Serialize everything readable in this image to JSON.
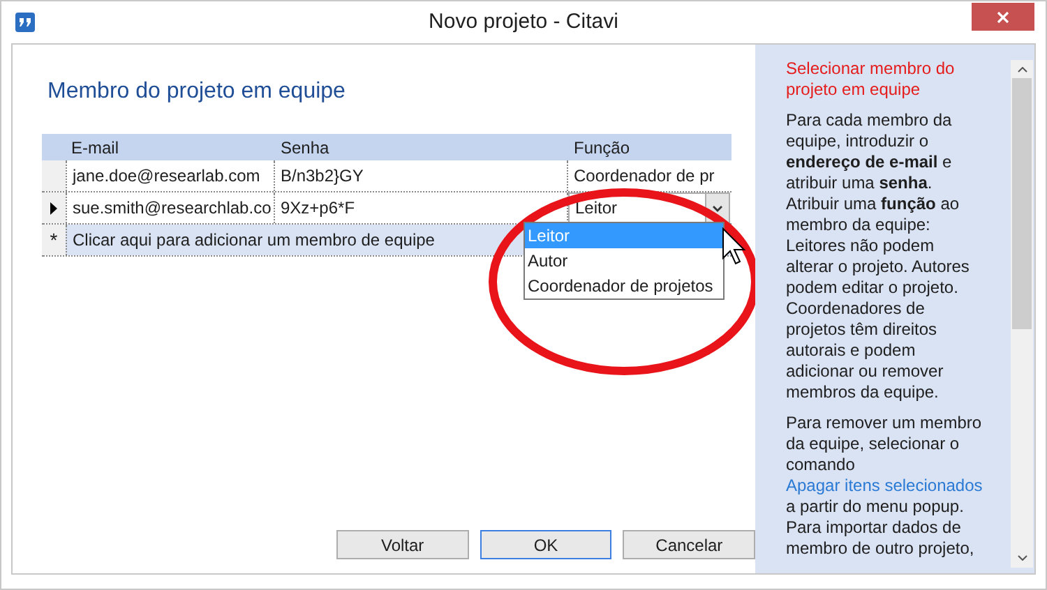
{
  "window": {
    "title": "Novo projeto - Citavi"
  },
  "heading": "Membro do projeto em equipe",
  "table": {
    "columns": [
      "E-mail",
      "Senha",
      "Função"
    ],
    "rows": [
      {
        "email": "jane.doe@researlab.com",
        "password": "B/n3b2}GY",
        "role": "Coordenador de pr",
        "current": false,
        "editing": false
      },
      {
        "email": "sue.smith@researchlab.co",
        "password": "9Xz+p6*F",
        "role": "Leitor",
        "current": true,
        "editing": true
      }
    ],
    "new_row": {
      "marker": "*",
      "text": "Clicar aqui para adicionar um membro de equipe"
    }
  },
  "dropdown": {
    "options": [
      {
        "label": "Leitor",
        "selected": true
      },
      {
        "label": "Autor",
        "selected": false
      },
      {
        "label": "Coordenador de projetos",
        "selected": false
      }
    ]
  },
  "buttons": [
    "Voltar",
    "OK",
    "Cancelar"
  ],
  "help": {
    "title": "Selecionar membro do projeto em equipe",
    "paragraph_1": "Para cada membro da equipe, introduzir o **endereço de e-mail** e atribuir uma **senha**. Atribuir uma **função** ao membro da equipe: Leitores não podem alterar o projeto. Autores podem editar o projeto. Coordenadores de projetos têm direitos autorais e podem adicionar ou remover membros da equipe.",
    "paragraph_2_before": "Para remover um membro da equipe, selecionar o comando",
    "paragraph_2_link": "Apagar itens selecionados",
    "paragraph_2_after": "a partir do menu popup. Para importar dados de membro de outro projeto,"
  }
}
